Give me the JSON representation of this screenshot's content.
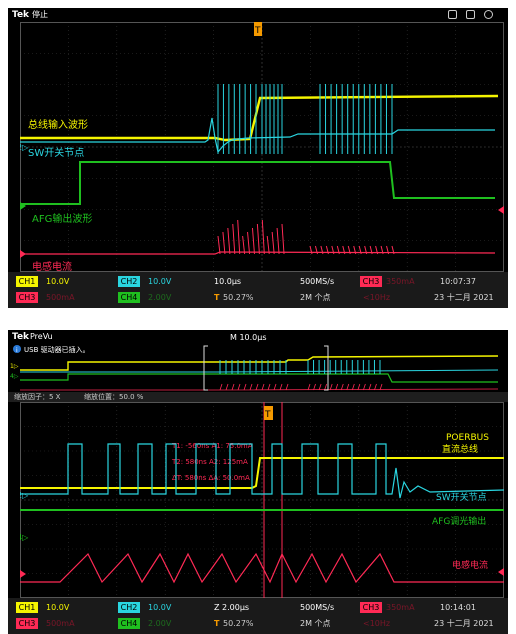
{
  "scope1": {
    "brand": "Tek",
    "status": "停止",
    "trigger_marker": "T",
    "labels": {
      "bus_wave": "总线输入波形",
      "sw_node": "SW开关节点",
      "afg_wave": "AFG输出波形",
      "inductor_current": "电感电流"
    },
    "bottom": {
      "ch1_label": "CH1",
      "ch1_scale": "10.0V",
      "ch2_label": "CH2",
      "ch2_scale": "10.0V",
      "ch3_label": "CH3",
      "ch3_scale": "500mA",
      "ch4_label": "CH4",
      "ch4_scale": "2.00V",
      "timebase": "10.0µs",
      "trig_pos": "50.27%",
      "sample_rate": "500MS/s",
      "record_len": "2M 个点",
      "trig_ch": "CH3",
      "trig_level": "350mA",
      "trig_freq": "<10Hz",
      "time": "10:07:37",
      "date": "23 十二月 2021"
    }
  },
  "scope2": {
    "brand": "Tek",
    "status": "PreVu",
    "header_timebase": "M 10.0µs",
    "usb_message": "USB 驱动器已插入。",
    "zoom_factor": "缩放因子：5 X",
    "zoom_position": "缩放位置：50.0 %",
    "trigger_marker": "T",
    "cursor_readout": {
      "t1": "T1: -560ns A1: 75.0mA",
      "t2": "T2: 580ns A2: 125mA",
      "delta": "ΔT: 580ns ΔA: 50.0mA"
    },
    "labels": {
      "poerbus_line1": "POERBUS",
      "poerbus_line2": "直流总线",
      "sw_node": "SW开关节点",
      "afg_dimming": "AFG调光输出",
      "inductor_current": "电感电流"
    },
    "bottom": {
      "ch1_label": "CH1",
      "ch1_scale": "10.0V",
      "ch2_label": "CH2",
      "ch2_scale": "10.0V",
      "ch3_label": "CH3",
      "ch3_scale": "500mA",
      "ch4_label": "CH4",
      "ch4_scale": "2.00V",
      "timebase": "Z 2.00µs",
      "trig_pos": "50.27%",
      "sample_rate": "500MS/s",
      "record_len": "2M 个点",
      "trig_ch": "CH3",
      "trig_level": "350mA",
      "trig_freq": "<10Hz",
      "time": "10:14:01",
      "date": "23 十二月 2021"
    }
  },
  "colors": {
    "ch1": "#f5f500",
    "ch2": "#2ad5e0",
    "ch3": "#ff2a55",
    "ch4": "#1fbf1f",
    "trigger": "#f59a00"
  }
}
